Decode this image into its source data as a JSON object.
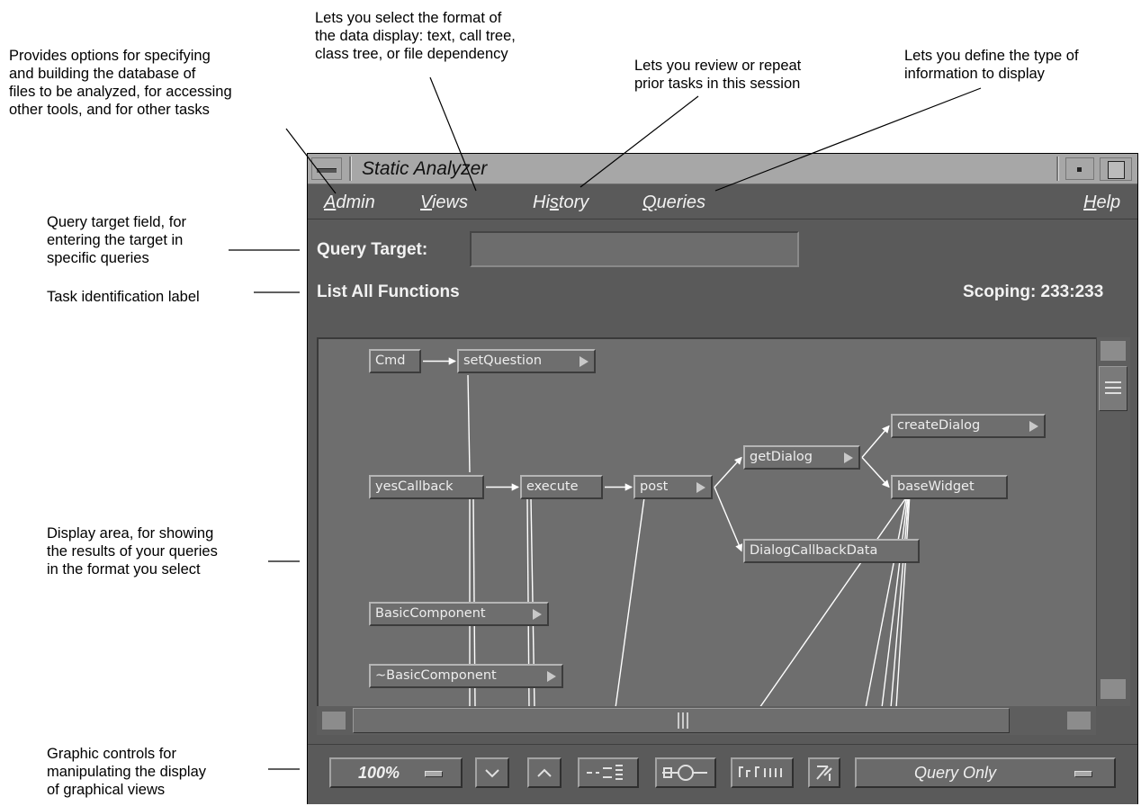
{
  "callouts": {
    "admin": "Provides options for specifying\nand building the database of\nfiles to be analyzed, for accessing\nother tools, and for other tasks",
    "views": "Lets you select the format of\nthe data display:  text, call tree,\nclass tree, or file dependency",
    "history": "Lets you review or repeat\nprior tasks in this session",
    "queries": "Lets you define the type of\ninformation to display",
    "query_target": "Query target field, for\nentering the target in\nspecific queries",
    "task_label": "Task identification label",
    "display_area": "Display area, for showing\nthe results of your queries\nin the format you select",
    "graphic_controls": "Graphic controls for\nmanipulating the display\nof graphical views"
  },
  "window": {
    "title": "Static Analyzer"
  },
  "menubar": {
    "admin": {
      "mnemonic": "A",
      "rest": "dmin"
    },
    "views": {
      "mnemonic": "V",
      "rest": "iews"
    },
    "history": {
      "before": "Hi",
      "mnemonic": "s",
      "rest": "tory"
    },
    "queries": {
      "mnemonic": "Q",
      "rest": "ueries"
    },
    "help": {
      "mnemonic": "H",
      "rest": "elp"
    }
  },
  "query_target": {
    "label": "Query Target:",
    "value": ""
  },
  "task": {
    "label": "List All Functions",
    "scoping": "Scoping: 233:233"
  },
  "graph": {
    "nodes": [
      {
        "id": "cmd",
        "label": "Cmd",
        "has_menu": false
      },
      {
        "id": "setQuestion",
        "label": "setQuestion",
        "has_menu": true
      },
      {
        "id": "yesCallback",
        "label": "yesCallback",
        "has_menu": false
      },
      {
        "id": "execute",
        "label": "execute",
        "has_menu": false
      },
      {
        "id": "post",
        "label": "post",
        "has_menu": true
      },
      {
        "id": "getDialog",
        "label": "getDialog",
        "has_menu": true
      },
      {
        "id": "createDialog",
        "label": "createDialog",
        "has_menu": true
      },
      {
        "id": "baseWidget",
        "label": "baseWidget",
        "has_menu": false
      },
      {
        "id": "dialogCallbackData",
        "label": "DialogCallbackData",
        "has_menu": false
      },
      {
        "id": "basicComponent",
        "label": "BasicComponent",
        "has_menu": true
      },
      {
        "id": "tildeBasicComponent",
        "label": "~BasicComponent",
        "has_menu": true
      }
    ],
    "edges": [
      [
        "cmd",
        "setQuestion"
      ],
      [
        "yesCallback",
        "execute"
      ],
      [
        "execute",
        "post"
      ],
      [
        "post",
        "getDialog"
      ],
      [
        "post",
        "dialogCallbackData"
      ],
      [
        "getDialog",
        "createDialog"
      ],
      [
        "getDialog",
        "baseWidget"
      ]
    ]
  },
  "controls": {
    "zoom": "100%",
    "mode": "Query Only",
    "icons": [
      "zoom-menu-icon",
      "collapse-icon",
      "expand-icon",
      "overview-icon",
      "graph-icon",
      "tree-layout-icon",
      "rotate-icon"
    ]
  }
}
